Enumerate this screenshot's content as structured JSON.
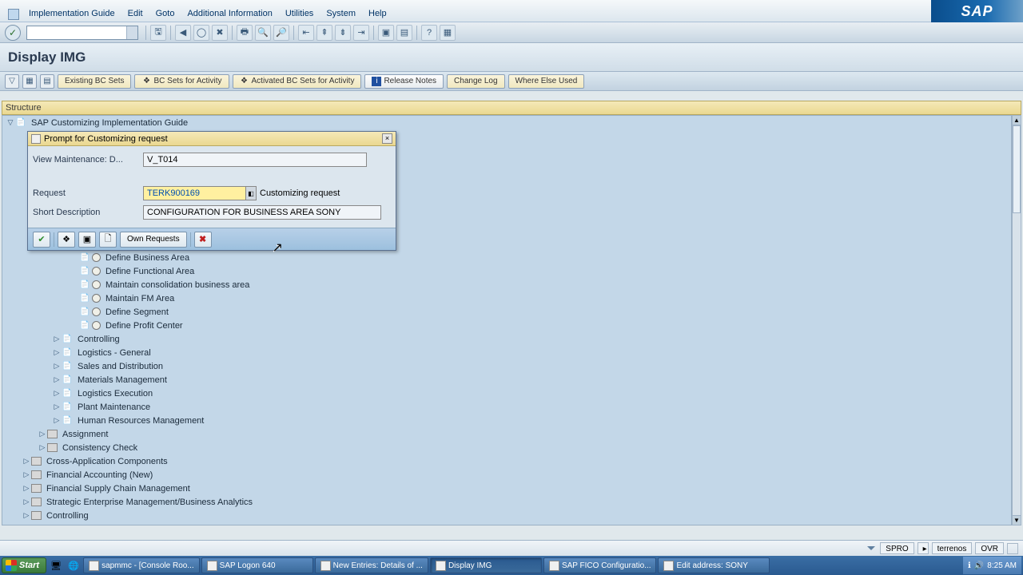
{
  "menubar": [
    "Implementation Guide",
    "Edit",
    "Goto",
    "Additional Information",
    "Utilities",
    "System",
    "Help"
  ],
  "page_title": "Display IMG",
  "app_toolbar": {
    "existing_bc": "Existing BC Sets",
    "bc_activity": "BC Sets for Activity",
    "activated_bc": "Activated BC Sets for Activity",
    "release_notes": "Release Notes",
    "change_log": "Change Log",
    "where_else": "Where Else Used"
  },
  "structure_label": "Structure",
  "tree": {
    "root": "SAP Customizing Implementation Guide",
    "leaves": [
      "Define Business Area",
      "Define Functional Area",
      "Maintain consolidation business area",
      "Maintain FM Area",
      "Define Segment",
      "Define Profit Center"
    ],
    "mid_folders": [
      "Controlling",
      "Logistics - General",
      "Sales and Distribution",
      "Materials Management",
      "Logistics Execution",
      "Plant Maintenance",
      "Human Resources Management"
    ],
    "sub2": [
      "Assignment",
      "Consistency Check"
    ],
    "top_folders": [
      "Cross-Application Components",
      "Financial Accounting (New)",
      "Financial Supply Chain Management",
      "Strategic Enterprise Management/Business Analytics",
      "Controlling"
    ]
  },
  "dialog": {
    "title": "Prompt for Customizing request",
    "view_label": "View Maintenance: D...",
    "view_value": "V_T014",
    "request_label": "Request",
    "request_value": "TERK900169",
    "request_after": "Customizing request",
    "short_desc_label": "Short Description",
    "short_desc_value": "CONFIGURATION FOR BUSINESS AREA SONY",
    "own_requests": "Own Requests"
  },
  "status": {
    "tcode": "SPRO",
    "host": "terrenos",
    "mode": "OVR"
  },
  "taskbar": {
    "start": "Start",
    "items": [
      "sapmmc - [Console Roo...",
      "SAP Logon 640",
      "New Entries: Details of ...",
      "Display IMG",
      "SAP FICO Configuratio...",
      "Edit address:  SONY"
    ],
    "time": "8:25 AM"
  },
  "sap_logo": "SAP"
}
